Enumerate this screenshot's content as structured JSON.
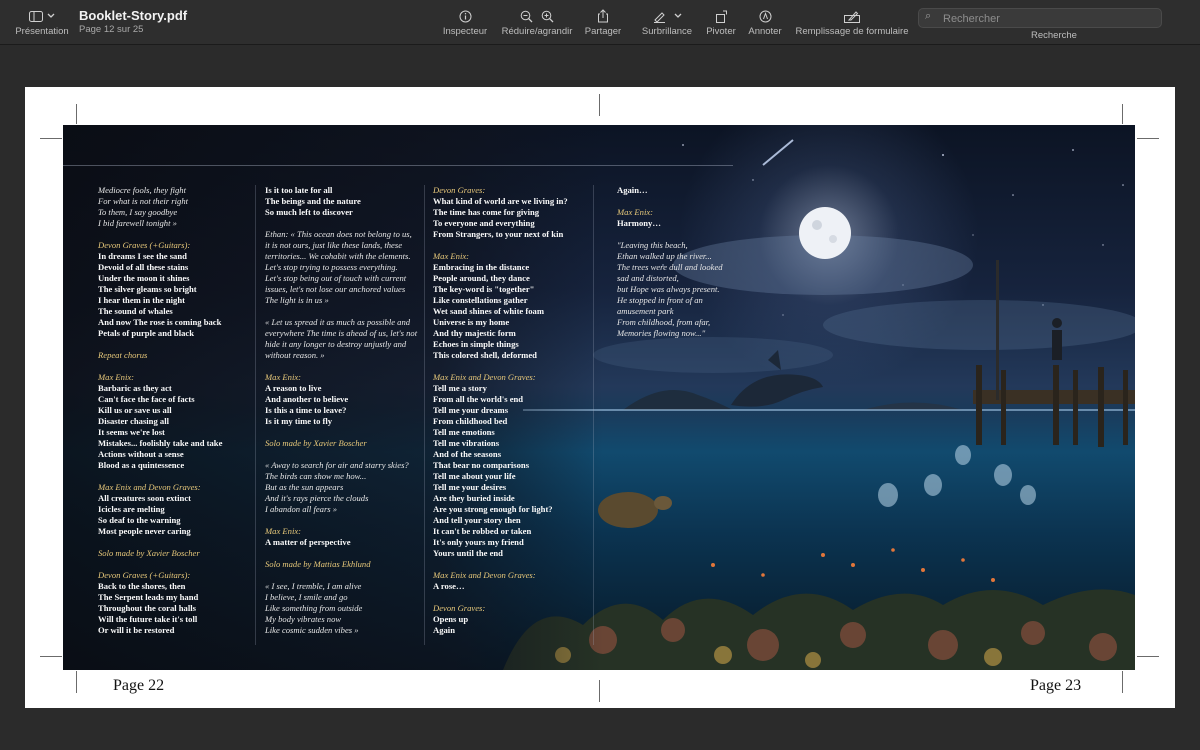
{
  "toolbar": {
    "view_label": "Présentation",
    "doc_title": "Booklet-Story.pdf",
    "page_info": "Page 12 sur 25",
    "tools": [
      {
        "label": "Inspecteur",
        "icon": "info-icon"
      },
      {
        "label": "Réduire/agrandir",
        "icon": "zoom-icon"
      },
      {
        "label": "Partager",
        "icon": "share-icon"
      },
      {
        "label": "Surbrillance",
        "icon": "highlighter-icon"
      },
      {
        "label": "Pivoter",
        "icon": "rotate-icon"
      },
      {
        "label": "Annoter",
        "icon": "annotate-icon"
      },
      {
        "label": "Remplissage de formulaire",
        "icon": "form-fill-icon"
      }
    ],
    "search": {
      "placeholder": "Rechercher",
      "label": "Recherche"
    }
  },
  "pages": {
    "left": "Page 22",
    "right": "Page 23"
  },
  "columns": [
    [
      {
        "s": "it",
        "t": "Mediocre fools, they fight"
      },
      {
        "s": "it",
        "t": "For what is not their right"
      },
      {
        "s": "it",
        "t": "To them, I say goodbye"
      },
      {
        "s": "it",
        "t": "I bid farewell tonight »"
      },
      {
        "s": "gap",
        "t": ""
      },
      {
        "s": "head",
        "t": "Devon Graves (+Guitars):"
      },
      {
        "s": "bd",
        "t": "In dreams I see the sand"
      },
      {
        "s": "bd",
        "t": "Devoid of all these stains"
      },
      {
        "s": "bd",
        "t": "Under the moon it shines"
      },
      {
        "s": "bd",
        "t": "The silver gleams so bright"
      },
      {
        "s": "bd",
        "t": "I hear them in the night"
      },
      {
        "s": "bd",
        "t": "The sound of whales"
      },
      {
        "s": "bd",
        "t": "And now The rose is coming back"
      },
      {
        "s": "bd",
        "t": "Petals of purple and black"
      },
      {
        "s": "gap",
        "t": ""
      },
      {
        "s": "head",
        "t": "Repeat chorus"
      },
      {
        "s": "gap",
        "t": ""
      },
      {
        "s": "head",
        "t": "Max Enix:"
      },
      {
        "s": "bd",
        "t": "Barbaric as they act"
      },
      {
        "s": "bd",
        "t": "Can't face the face of facts"
      },
      {
        "s": "bd",
        "t": "Kill us or save us all"
      },
      {
        "s": "bd",
        "t": "Disaster chasing all"
      },
      {
        "s": "bd",
        "t": "It seems we're lost"
      },
      {
        "s": "bd",
        "t": "Mistakes... foolishly take and take"
      },
      {
        "s": "bd",
        "t": "Actions without a sense"
      },
      {
        "s": "bd",
        "t": "Blood as a quintessence"
      },
      {
        "s": "gap",
        "t": ""
      },
      {
        "s": "head",
        "t": "Max Enix and Devon Graves:"
      },
      {
        "s": "bd",
        "t": "All creatures soon extinct"
      },
      {
        "s": "bd",
        "t": "Icicles are melting"
      },
      {
        "s": "bd",
        "t": "So deaf to the warning"
      },
      {
        "s": "bd",
        "t": "Most people never caring"
      },
      {
        "s": "gap",
        "t": ""
      },
      {
        "s": "head",
        "t": "Solo made by Xavier Boscher"
      },
      {
        "s": "gap",
        "t": ""
      },
      {
        "s": "head",
        "t": "Devon Graves (+Guitars):"
      },
      {
        "s": "bd",
        "t": "Back to the shores, then"
      },
      {
        "s": "bd",
        "t": "The Serpent leads my hand"
      },
      {
        "s": "bd",
        "t": "Throughout the coral halls"
      },
      {
        "s": "bd",
        "t": "Will the future take it's toll"
      },
      {
        "s": "bd",
        "t": "Or will it be restored"
      }
    ],
    [
      {
        "s": "bd",
        "t": "Is it too late for all"
      },
      {
        "s": "bd",
        "t": "The beings and the nature"
      },
      {
        "s": "bd",
        "t": "So much left to discover"
      },
      {
        "s": "gap",
        "t": ""
      },
      {
        "s": "it",
        "t": "Ethan: « This ocean does not belong to us,"
      },
      {
        "s": "it",
        "t": "it is not ours, just like these lands, these"
      },
      {
        "s": "it",
        "t": "territories... We cohabit with the elements."
      },
      {
        "s": "it",
        "t": "Let's stop trying to possess everything."
      },
      {
        "s": "it",
        "t": "Let's stop being out of touch with current"
      },
      {
        "s": "it",
        "t": "issues, let's not lose our anchored values"
      },
      {
        "s": "it",
        "t": "The light is in us »"
      },
      {
        "s": "gap",
        "t": ""
      },
      {
        "s": "it",
        "t": "« Let us spread it as much as possible and"
      },
      {
        "s": "it",
        "t": "everywhere The time is ahead of us, let's not"
      },
      {
        "s": "it",
        "t": "hide it any longer to destroy unjustly and"
      },
      {
        "s": "it",
        "t": "without reason. »"
      },
      {
        "s": "gap",
        "t": ""
      },
      {
        "s": "head",
        "t": "Max Enix:"
      },
      {
        "s": "bd",
        "t": "A reason to live"
      },
      {
        "s": "bd",
        "t": "And another to believe"
      },
      {
        "s": "bd",
        "t": "Is this a time to leave?"
      },
      {
        "s": "bd",
        "t": "Is it my time to fly"
      },
      {
        "s": "gap",
        "t": ""
      },
      {
        "s": "head",
        "t": "Solo made by Xavier Boscher"
      },
      {
        "s": "gap",
        "t": ""
      },
      {
        "s": "it",
        "t": "« Away to search for air and starry skies?"
      },
      {
        "s": "it",
        "t": "The birds can show me how..."
      },
      {
        "s": "it",
        "t": "But as the sun appears"
      },
      {
        "s": "it",
        "t": "And it's rays pierce the clouds"
      },
      {
        "s": "it",
        "t": "I abandon all fears »"
      },
      {
        "s": "gap",
        "t": ""
      },
      {
        "s": "head",
        "t": "Max Enix:"
      },
      {
        "s": "bd",
        "t": "A matter of perspective"
      },
      {
        "s": "gap",
        "t": ""
      },
      {
        "s": "head",
        "t": "Solo made by Mattias Ekhlund"
      },
      {
        "s": "gap",
        "t": ""
      },
      {
        "s": "it",
        "t": "« I see, I tremble, I am alive"
      },
      {
        "s": "it",
        "t": "I believe, I smile and go"
      },
      {
        "s": "it",
        "t": "Like something from outside"
      },
      {
        "s": "it",
        "t": "My body vibrates now"
      },
      {
        "s": "it",
        "t": "Like cosmic sudden vibes »"
      }
    ],
    [
      {
        "s": "head",
        "t": "Devon Graves:"
      },
      {
        "s": "bd",
        "t": "What kind of world are we living in?"
      },
      {
        "s": "bd",
        "t": "The time has come for giving"
      },
      {
        "s": "bd",
        "t": "To everyone and everything"
      },
      {
        "s": "bd",
        "t": "From Strangers, to your next of kin"
      },
      {
        "s": "gap",
        "t": ""
      },
      {
        "s": "head",
        "t": "Max Enix:"
      },
      {
        "s": "bd",
        "t": "Embracing in the distance"
      },
      {
        "s": "bd",
        "t": "People around, they dance"
      },
      {
        "s": "bd",
        "t": "The key-word is \"together\""
      },
      {
        "s": "bd",
        "t": "Like constellations gather"
      },
      {
        "s": "bd",
        "t": "Wet sand shines of white foam"
      },
      {
        "s": "bd",
        "t": "Universe is my home"
      },
      {
        "s": "bd",
        "t": "And thy majestic form"
      },
      {
        "s": "bd",
        "t": "Echoes in simple things"
      },
      {
        "s": "bd",
        "t": "This colored shell, deformed"
      },
      {
        "s": "gap",
        "t": ""
      },
      {
        "s": "head",
        "t": "Max Enix and Devon Graves:"
      },
      {
        "s": "bd",
        "t": "Tell me a story"
      },
      {
        "s": "bd",
        "t": "From all the world's end"
      },
      {
        "s": "bd",
        "t": "Tell me your dreams"
      },
      {
        "s": "bd",
        "t": "From childhood bed"
      },
      {
        "s": "bd",
        "t": "Tell me emotions"
      },
      {
        "s": "bd",
        "t": "Tell me vibrations"
      },
      {
        "s": "bd",
        "t": "And of the seasons"
      },
      {
        "s": "bd",
        "t": "That bear no comparisons"
      },
      {
        "s": "bd",
        "t": "Tell me about your life"
      },
      {
        "s": "bd",
        "t": "Tell me your desires"
      },
      {
        "s": "bd",
        "t": "Are they buried inside"
      },
      {
        "s": "bd",
        "t": "Are you strong enough for light?"
      },
      {
        "s": "bd",
        "t": "And tell your story then"
      },
      {
        "s": "bd",
        "t": "It can't be robbed or taken"
      },
      {
        "s": "bd",
        "t": "It's only yours my friend"
      },
      {
        "s": "bd",
        "t": "Yours until the end"
      },
      {
        "s": "gap",
        "t": ""
      },
      {
        "s": "head",
        "t": "Max Enix and Devon Graves:"
      },
      {
        "s": "bd",
        "t": "A rose…"
      },
      {
        "s": "gap",
        "t": ""
      },
      {
        "s": "head",
        "t": "Devon Graves:"
      },
      {
        "s": "bd",
        "t": "Opens up"
      },
      {
        "s": "bd",
        "t": "Again"
      }
    ],
    [
      {
        "s": "bd",
        "t": "Again…"
      },
      {
        "s": "gap",
        "t": ""
      },
      {
        "s": "head",
        "t": "Max Enix:"
      },
      {
        "s": "bd",
        "t": "Harmony…"
      },
      {
        "s": "gap",
        "t": ""
      },
      {
        "s": "it",
        "t": "\"Leaving this beach,"
      },
      {
        "s": "it",
        "t": "Ethan walked up the river..."
      },
      {
        "s": "it",
        "t": "The trees were dull and looked"
      },
      {
        "s": "it",
        "t": " sad and distorted,"
      },
      {
        "s": "it",
        "t": "but Hope was always present."
      },
      {
        "s": "it",
        "t": "He stopped in front of an"
      },
      {
        "s": "it",
        "t": "amusement park"
      },
      {
        "s": "it",
        "t": "From childhood, from afar,"
      },
      {
        "s": "it",
        "t": "Memories flowing now...\""
      }
    ]
  ]
}
